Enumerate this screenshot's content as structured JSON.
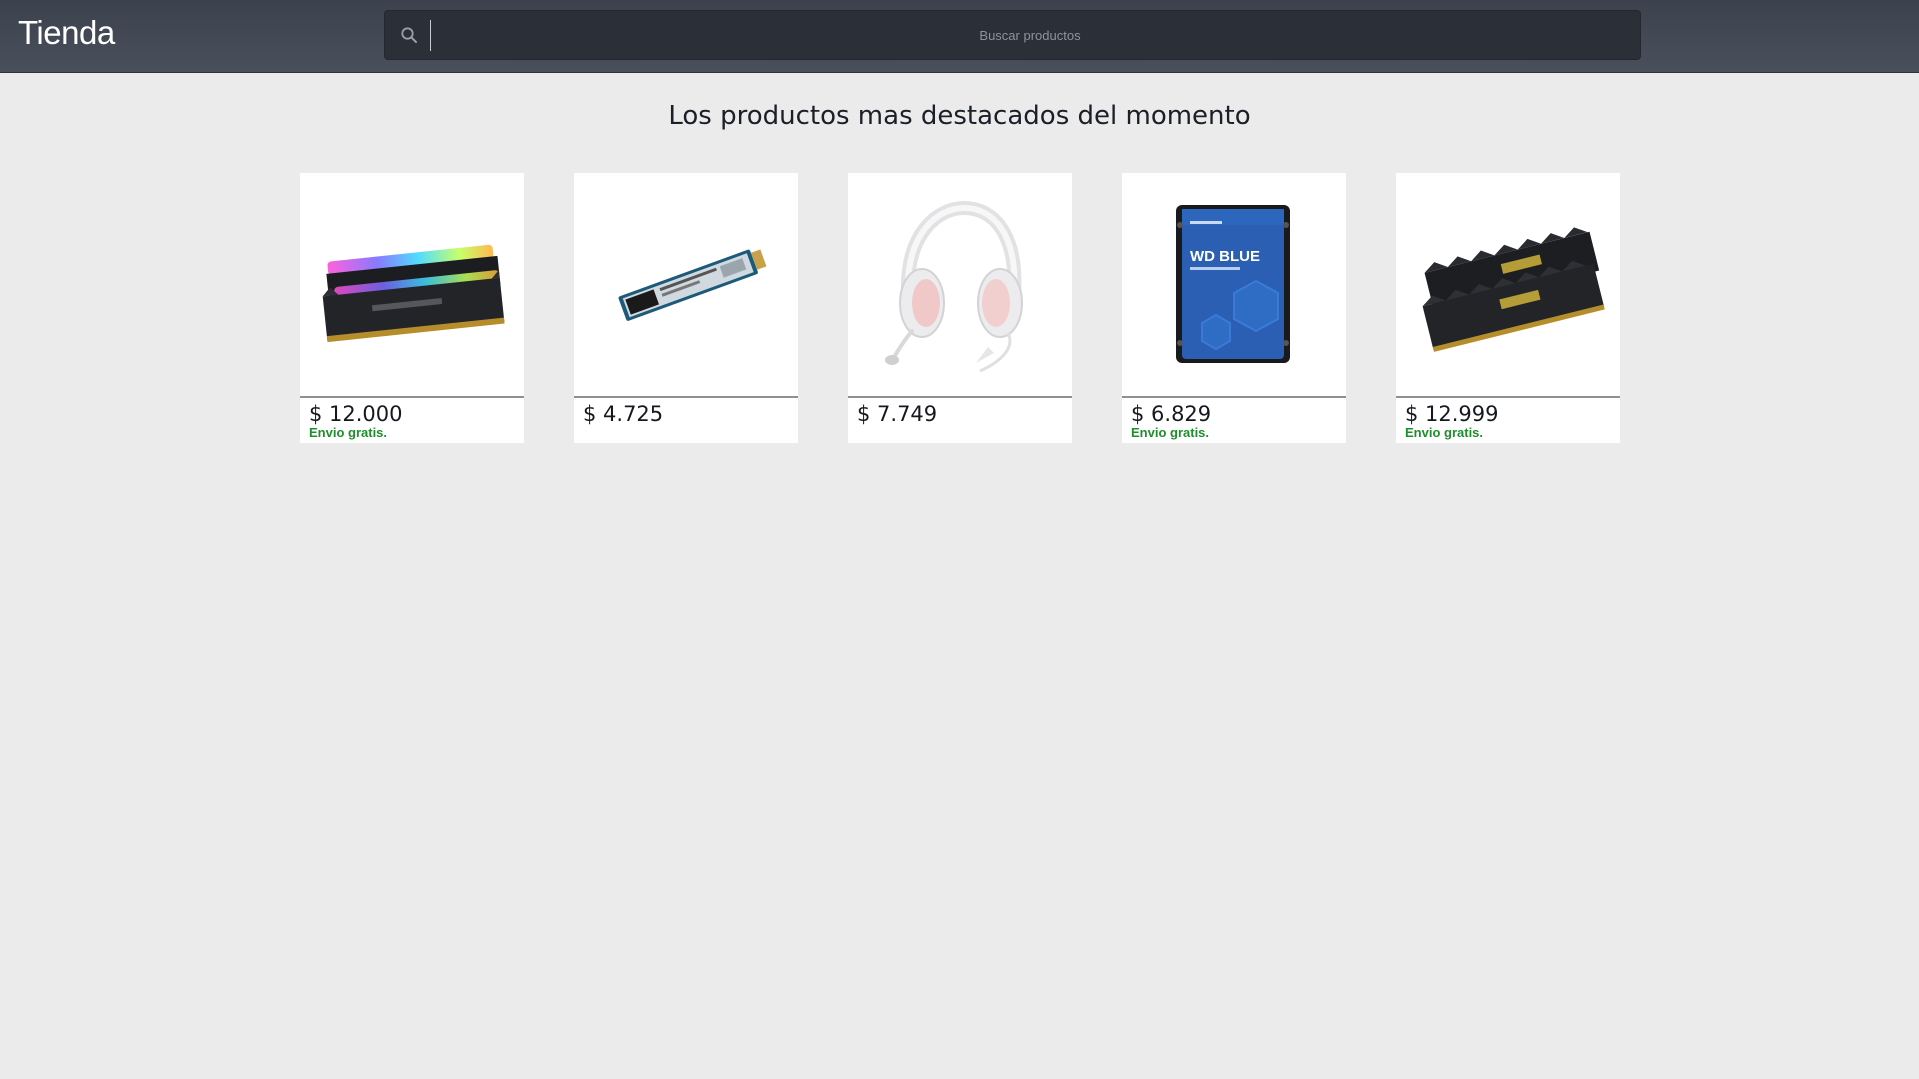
{
  "brand": "Tienda",
  "search": {
    "placeholder": "Buscar productos",
    "value": ""
  },
  "heading": "Los productos mas destacados del momento",
  "colors": {
    "topbar": "#434953",
    "background": "#ebebeb",
    "shipping": "#1e8f2c"
  },
  "products": [
    {
      "image_icon": "rgb-ram-image",
      "price": "$ 12.000",
      "shipping": "Envio gratis."
    },
    {
      "image_icon": "m2-ssd-image",
      "price": "$ 4.725",
      "shipping": ""
    },
    {
      "image_icon": "headset-image",
      "price": "$ 7.749",
      "shipping": ""
    },
    {
      "image_icon": "hard-drive-image",
      "price": "$ 6.829",
      "shipping": "Envio gratis."
    },
    {
      "image_icon": "ram-kit-image",
      "price": "$ 12.999",
      "shipping": "Envio gratis."
    }
  ]
}
